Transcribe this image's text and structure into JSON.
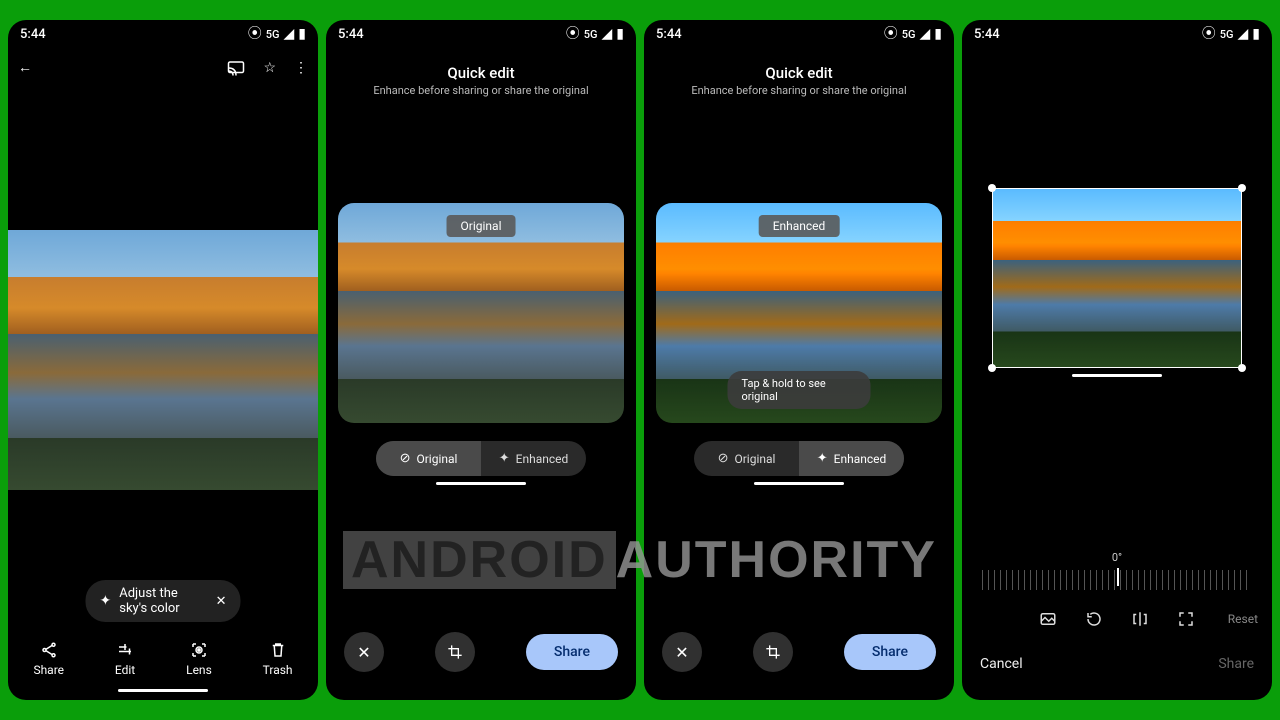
{
  "status": {
    "time": "5:44",
    "net": "5G"
  },
  "screen1": {
    "chip": "Adjust the sky's color",
    "actions": {
      "share": "Share",
      "edit": "Edit",
      "lens": "Lens",
      "trash": "Trash"
    }
  },
  "quick_edit": {
    "title": "Quick edit",
    "subtitle": "Enhance before sharing or share the original",
    "badge_original": "Original",
    "badge_enhanced": "Enhanced",
    "tap_hold": "Tap & hold to see original",
    "seg_original": "Original",
    "seg_enhanced": "Enhanced",
    "share": "Share"
  },
  "crop": {
    "angle": "0°",
    "reset": "Reset",
    "cancel": "Cancel",
    "share": "Share"
  },
  "watermark": {
    "a": "ANDROID",
    "b": "AUTHORITY"
  }
}
